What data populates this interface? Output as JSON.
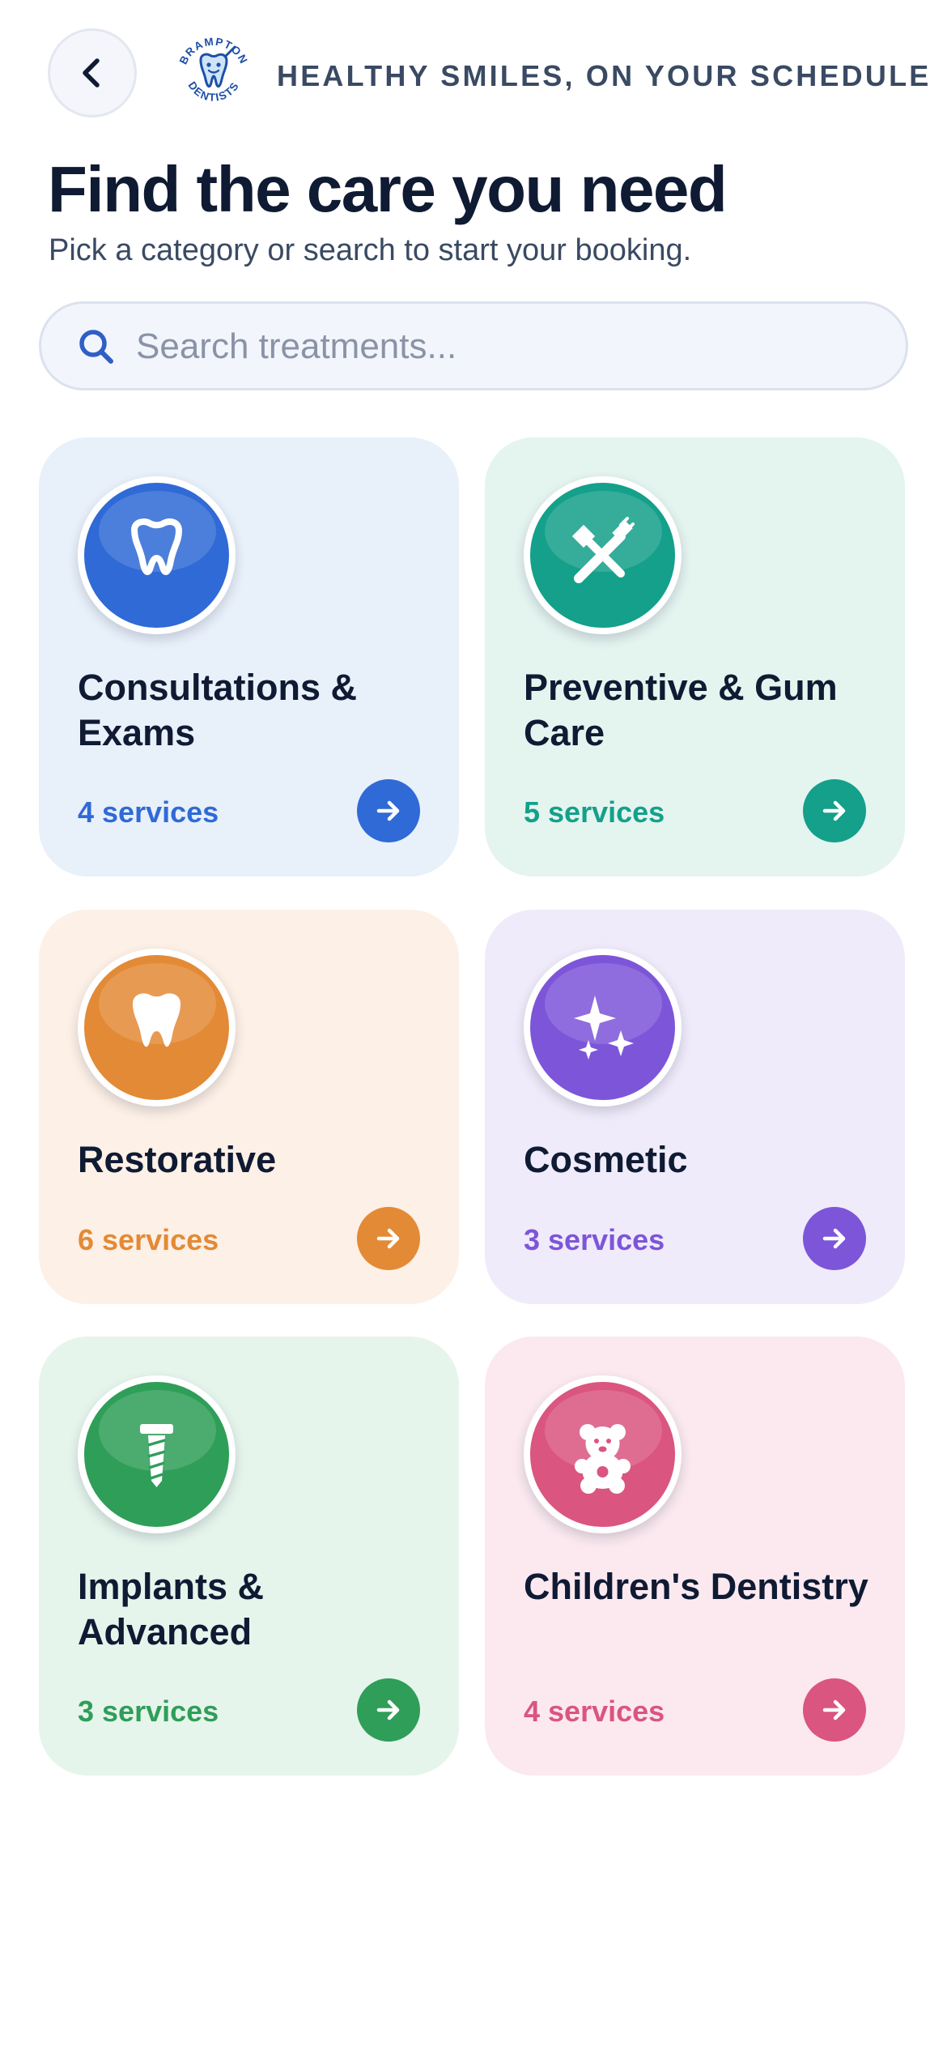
{
  "header": {
    "tagline": "HEALTHY SMILES, ON YOUR SCHEDULE",
    "logo_text_top": "BRAMPTON",
    "logo_text_bottom": "DENTISTS"
  },
  "title": "Find the care you need",
  "subtitle": "Pick a category or search to start your booking.",
  "search": {
    "placeholder": "Search treatments..."
  },
  "categories": [
    {
      "title": "Consultations & Exams",
      "count": "4 services",
      "icon": "tooth-icon",
      "color": "#2f6ad6",
      "bg": "#e8f0fa"
    },
    {
      "title": "Preventive & Gum Care",
      "count": "5 services",
      "icon": "toothbrush-icon",
      "color": "#14a08a",
      "bg": "#e4f4ef"
    },
    {
      "title": "Restorative",
      "count": "6 services",
      "icon": "tooth-icon",
      "color": "#e38a36",
      "bg": "#fdf0e6"
    },
    {
      "title": "Cosmetic",
      "count": "3 services",
      "icon": "sparkles-icon",
      "color": "#7d55d9",
      "bg": "#efebfa"
    },
    {
      "title": "Implants & Advanced",
      "count": "3 services",
      "icon": "implant-screw-icon",
      "color": "#2f9e58",
      "bg": "#e6f5ec"
    },
    {
      "title": "Children's Dentistry",
      "count": "4 services",
      "icon": "teddy-bear-icon",
      "color": "#da557f",
      "bg": "#fbe9ef"
    }
  ]
}
